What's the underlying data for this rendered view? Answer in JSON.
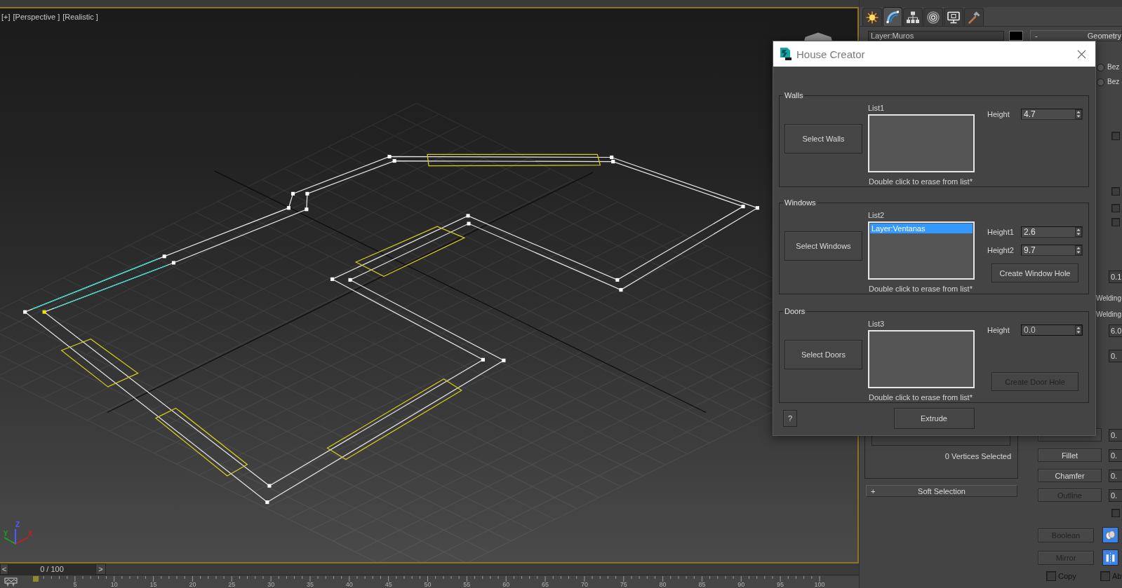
{
  "viewport": {
    "menus": [
      "[+]",
      "[Perspective ]",
      "[Realistic ]"
    ],
    "axes": [
      {
        "label": "X",
        "color": "#c81c1c"
      },
      {
        "label": "Y",
        "color": "#1c9a1c"
      },
      {
        "label": "Z",
        "color": "#4a5cff"
      }
    ]
  },
  "time_slider": {
    "back": "<",
    "frame": "0 / 100",
    "forward": ">",
    "level": 0
  },
  "time_ruler": {
    "labels": [
      "5",
      "10",
      "15",
      "20",
      "25",
      "30",
      "35",
      "40",
      "45",
      "50",
      "55",
      "60",
      "65",
      "70",
      "75",
      "80",
      "85",
      "90",
      "95",
      "100"
    ]
  },
  "command_panel": {
    "tabs": [
      {
        "selected": false
      },
      {
        "selected": true
      },
      {
        "selected": false
      },
      {
        "selected": false
      },
      {
        "selected": false
      },
      {
        "selected": false
      }
    ],
    "object_name": "Layer:Muros",
    "selection": {
      "status": "0 Vertices Selected"
    },
    "soft_selection": {
      "sign": "+",
      "title": "Soft Selection"
    },
    "geometry": {
      "sign": "-",
      "title": "Geometry",
      "radios": [
        {
          "label": "Bez",
          "selected": false
        },
        {
          "label": "Bez",
          "selected": false
        }
      ],
      "rows": [
        {
          "kind": "checkbox",
          "checked": false
        },
        {
          "kind": "checkbox",
          "checked": false
        },
        {
          "kind": "checkbox",
          "checked": false
        },
        {
          "kind": "checkbox",
          "checked": false
        },
        {
          "kind": "field",
          "value": "0.1"
        },
        {
          "kind": "label",
          "text": "Welding"
        },
        {
          "kind": "label",
          "text": "Welding"
        },
        {
          "kind": "field",
          "value": "6.0"
        },
        {
          "kind": "field",
          "value": "0."
        },
        {
          "kind": "button",
          "value": "0."
        },
        {
          "kind": "button",
          "label": "Fillet",
          "disabled": false,
          "value": "0."
        },
        {
          "kind": "button",
          "label": "Chamfer",
          "disabled": false,
          "value": "0."
        },
        {
          "kind": "button",
          "label": "Outline",
          "disabled": true,
          "value": "0."
        },
        {
          "kind": "checkbox",
          "checked": false
        },
        {
          "kind": "tool",
          "label": "Boolean",
          "disabled": true,
          "active": true
        },
        {
          "kind": "tool",
          "label": "Mirror",
          "disabled": true,
          "active": true
        },
        {
          "kind": "options",
          "checks": [
            {
              "label": "Copy",
              "checked": false,
              "disabled": true
            },
            {
              "label": "Ab",
              "checked": false,
              "disabled": true
            }
          ]
        }
      ]
    }
  },
  "dialog": {
    "title": "House Creator",
    "groups": [
      {
        "title": "Walls",
        "button": "Select Walls",
        "list_label": "List1",
        "hint": "Double click to erase from list*",
        "fields": [
          {
            "label": "Height",
            "value": "4.7",
            "disabled": false
          }
        ]
      },
      {
        "title": "Windows",
        "button": "Select Windows",
        "list_label": "List2",
        "items": [
          {
            "text": "Layer:Ventanas",
            "selected": true
          }
        ],
        "hint": "Double click to erase from list*",
        "fields": [
          {
            "label": "Height1",
            "value": "2.6",
            "disabled": false
          },
          {
            "label": "Height2",
            "value": "9.7",
            "disabled": false
          }
        ],
        "action": {
          "label": "Create Window Hole",
          "disabled": false
        }
      },
      {
        "title": "Doors",
        "button": "Select Doors",
        "list_label": "List3",
        "hint": "Double click to erase from list*",
        "fields": [
          {
            "label": "Height",
            "value": "0.0",
            "disabled": true
          }
        ],
        "action": {
          "label": "Create Door Hole",
          "disabled": true
        }
      }
    ],
    "help": "?",
    "extrude": "Extrude"
  }
}
